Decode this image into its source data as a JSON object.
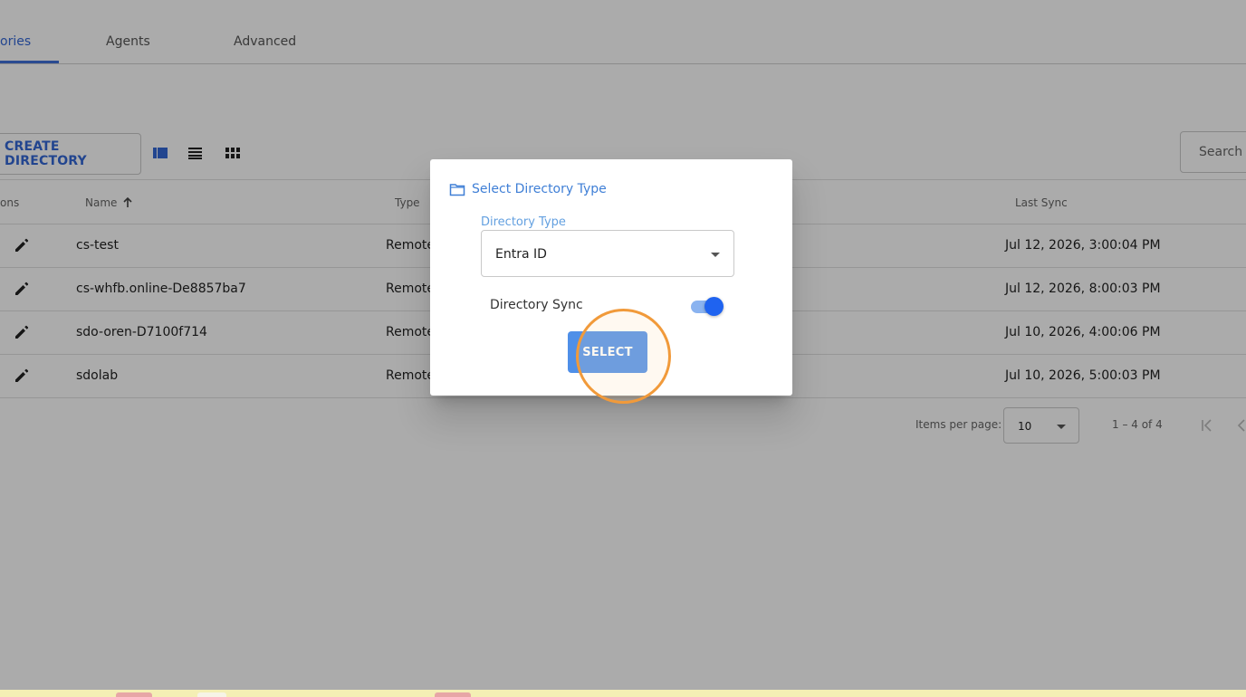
{
  "tabs": [
    {
      "label": "ories",
      "active": true
    },
    {
      "label": "Agents",
      "active": false
    },
    {
      "label": "Advanced",
      "active": false
    }
  ],
  "toolbar": {
    "create_label": "CREATE DIRECTORY",
    "view_icons": [
      "card-view-icon",
      "list-view-icon",
      "grid-view-icon"
    ],
    "search_placeholder": "Search"
  },
  "table": {
    "headers": {
      "actions": "ons",
      "name": "Name",
      "type": "Type",
      "last_sync": "Last Sync"
    },
    "rows": [
      {
        "name": "cs-test",
        "type": "Remote",
        "last_sync": "Jul 12, 2026, 3:00:04 PM"
      },
      {
        "name": "cs-whfb.online-De8857ba7",
        "type": "Remote",
        "last_sync": "Jul 12, 2026, 8:00:03 PM"
      },
      {
        "name": "sdo-oren-D7100f714",
        "type": "Remote",
        "last_sync": "Jul 10, 2026, 4:00:06 PM"
      },
      {
        "name": "sdolab",
        "type": "Remote",
        "last_sync": "Jul 10, 2026, 5:00:03 PM"
      }
    ]
  },
  "paginator": {
    "items_per_page_label": "Items per page:",
    "page_size": "10",
    "range": "1 – 4 of 4"
  },
  "dialog": {
    "title": "Select Directory Type",
    "directory_type_label": "Directory Type",
    "directory_type_value": "Entra ID",
    "sync_label": "Directory Sync",
    "sync_enabled": true,
    "select_label": "SELECT"
  },
  "colors": {
    "accent": "#3367d6",
    "button": "#4f8fe8",
    "toggle_thumb": "#1f63f0",
    "highlight": "#f19a3a"
  }
}
